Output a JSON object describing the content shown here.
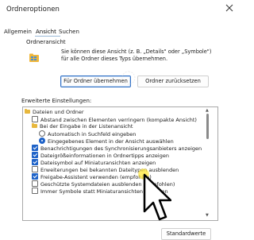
{
  "window": {
    "title": "Ordneroptionen",
    "close_icon": "close-icon"
  },
  "tabs": [
    {
      "label": "Allgemein",
      "active": false
    },
    {
      "label": "Ansicht",
      "active": true
    },
    {
      "label": "Suchen",
      "active": false
    }
  ],
  "folder_view": {
    "section_label": "Ordneransicht",
    "icon": "folder-view-icon",
    "description_line1": "Sie können diese Ansicht (z. B. „Details\" oder „Symbole\")",
    "description_line2": "für alle Ordner dieses Typs übernehmen.",
    "apply_button": "Für Ordner übernehmen",
    "reset_button": "Ordner zurücksetzen"
  },
  "advanced": {
    "label": "Erweiterte Einstellungen:",
    "items": [
      {
        "type": "folder",
        "label": "Dateien und Ordner"
      },
      {
        "type": "checkbox",
        "checked": false,
        "label": "Abstand zwischen Elementen verringern (kompakte Ansicht)"
      },
      {
        "type": "folder",
        "label": "Bei der Eingabe in der Listenansicht"
      },
      {
        "type": "radio",
        "checked": false,
        "label": "Automatisch in Suchfeld eingeben"
      },
      {
        "type": "radio",
        "checked": true,
        "label": "Eingegebenes Element in der Ansicht auswählen"
      },
      {
        "type": "checkbox",
        "checked": true,
        "label": "Benachrichtigungen des Synchronisierungsanbieters anzeigen"
      },
      {
        "type": "checkbox",
        "checked": true,
        "label": "Dateigrößeinformationen in Ordnertipps anzeigen"
      },
      {
        "type": "checkbox",
        "checked": true,
        "label": "Dateisymbol auf Miniaturansichten anzeigen"
      },
      {
        "type": "checkbox",
        "checked": false,
        "label": "Erweiterungen bei bekannten Dateitypen ausblenden"
      },
      {
        "type": "checkbox",
        "checked": true,
        "label": "Freigabe-Assistent verwenden (empfohlen)"
      },
      {
        "type": "checkbox",
        "checked": false,
        "label": "Geschützte Systemdateien ausblenden (empfohlen)"
      },
      {
        "type": "checkbox",
        "checked": false,
        "label": "Immer Symbole statt Miniaturansichten anzeigen"
      }
    ],
    "scroll_up": "▲",
    "scroll_down": "▼"
  },
  "footer": {
    "defaults_button": "Standardwerte"
  },
  "colors": {
    "accent": "#1f63c8",
    "highlight": "#ffe84a"
  }
}
